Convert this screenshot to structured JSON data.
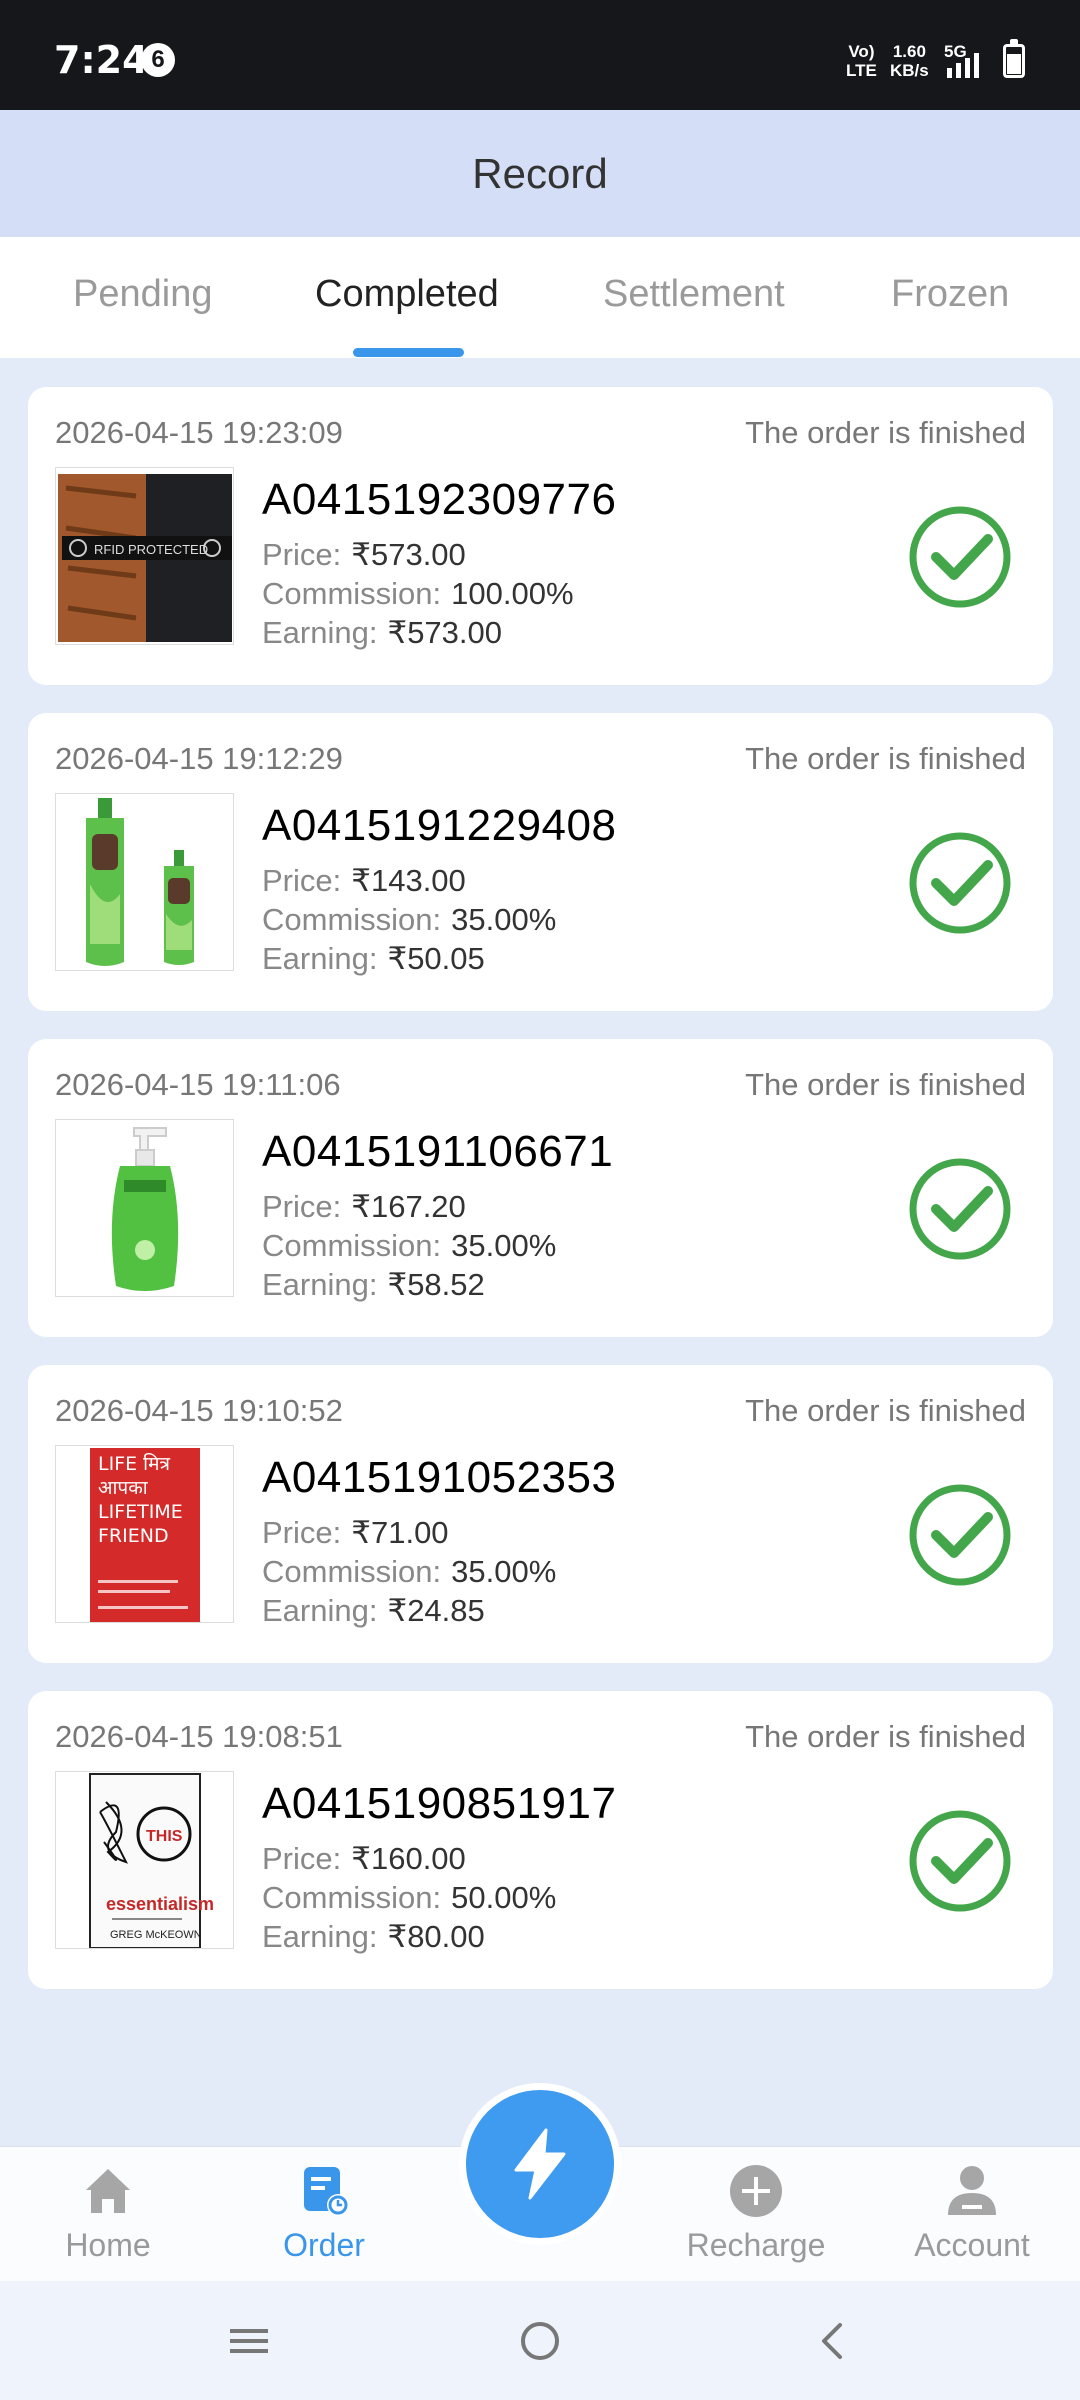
{
  "status_bar": {
    "time": "7:24",
    "notification_count": "6",
    "network_left_top": "Vo)",
    "network_left_bottom": "LTE",
    "speed_value": "1.60",
    "speed_unit": "KB/s",
    "network_type": "5G"
  },
  "header": {
    "title": "Record"
  },
  "tabs": [
    {
      "label": "Pending",
      "active": false
    },
    {
      "label": "Completed",
      "active": true
    },
    {
      "label": "Settlement",
      "active": false
    },
    {
      "label": "Frozen",
      "active": false
    }
  ],
  "field_labels": {
    "price": "Price:",
    "commission": "Commission:",
    "earning": "Earning:"
  },
  "orders": [
    {
      "datetime": "2026-04-15 19:23:09",
      "status": "The order is finished",
      "order_no": "A0415192309776",
      "price": "₹573.00",
      "commission": "100.00%",
      "earning": "₹573.00",
      "product": "wallet",
      "product_text": "RFID PROTECTED"
    },
    {
      "datetime": "2026-04-15 19:12:29",
      "status": "The order is finished",
      "order_no": "A0415191229408",
      "price": "₹143.00",
      "commission": "35.00%",
      "earning": "₹50.05",
      "product": "hair-oil-bottles"
    },
    {
      "datetime": "2026-04-15 19:11:06",
      "status": "The order is finished",
      "order_no": "A0415191106671",
      "price": "₹167.20",
      "commission": "35.00%",
      "earning": "₹58.52",
      "product": "face-wash-pump-bottle"
    },
    {
      "datetime": "2026-04-15 19:10:52",
      "status": "The order is finished",
      "order_no": "A0415191052353",
      "price": "₹71.00",
      "commission": "35.00%",
      "earning": "₹24.85",
      "product": "book-red",
      "product_text_lines": [
        "LIFE मित्र",
        "आपका",
        "LIFETIME",
        "FRIEND"
      ]
    },
    {
      "datetime": "2026-04-15 19:08:51",
      "status": "The order is finished",
      "order_no": "A0415190851917",
      "price": "₹160.00",
      "commission": "50.00%",
      "earning": "₹80.00",
      "product": "book-essentialism",
      "product_text": "essentialism",
      "product_badge": "THIS",
      "product_author": "GREG McKEOWN"
    }
  ],
  "bottom_nav": [
    {
      "label": "Home",
      "icon": "home-icon",
      "active": false
    },
    {
      "label": "Order",
      "icon": "order-icon",
      "active": true
    },
    {
      "label": "Recharge",
      "icon": "plus-circle-icon",
      "active": false
    },
    {
      "label": "Account",
      "icon": "user-icon",
      "active": false
    }
  ],
  "fab": {
    "icon": "lightning-icon"
  },
  "colors": {
    "accent": "#3a96ea",
    "check_green": "#43a64a",
    "header_bg": "#d4def6",
    "page_bg": "#e3eaf8"
  }
}
